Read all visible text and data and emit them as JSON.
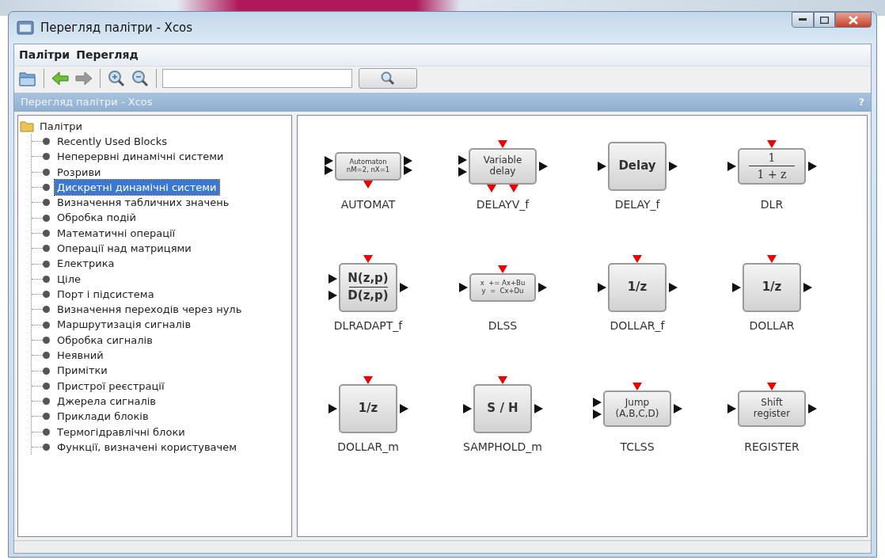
{
  "window": {
    "title": "Перегляд палітри - Xcos"
  },
  "menu": [
    "Палітри",
    "Перегляд"
  ],
  "toolbar": {
    "back": {
      "disabled": false
    },
    "forward": {
      "disabled": true
    }
  },
  "header": {
    "title": "Перегляд палітри - Xcos",
    "help": "?"
  },
  "tree": {
    "label": "Палітри",
    "children": [
      {
        "label": "Recently Used Blocks",
        "selected": false
      },
      {
        "label": "Неперервні динамічні системи",
        "selected": false
      },
      {
        "label": "Розриви",
        "selected": false
      },
      {
        "label": "Дискретні динамічні системи",
        "selected": true
      },
      {
        "label": "Визначення табличних значень",
        "selected": false
      },
      {
        "label": "Обробка подій",
        "selected": false
      },
      {
        "label": "Математичні операції",
        "selected": false
      },
      {
        "label": "Операції над матрицями",
        "selected": false
      },
      {
        "label": "Електрика",
        "selected": false
      },
      {
        "label": "Ціле",
        "selected": false
      },
      {
        "label": "Порт і підсистема",
        "selected": false
      },
      {
        "label": "Визначення переходів через нуль",
        "selected": false
      },
      {
        "label": "Маршрутизація сигналів",
        "selected": false
      },
      {
        "label": "Обробка сигналів",
        "selected": false
      },
      {
        "label": "Неявний",
        "selected": false
      },
      {
        "label": "Примітки",
        "selected": false
      },
      {
        "label": "Пристрої реєстрації",
        "selected": false
      },
      {
        "label": "Джерела сигналів",
        "selected": false
      },
      {
        "label": "Приклади блоків",
        "selected": false
      },
      {
        "label": "Термогідравлічні блоки",
        "selected": false
      },
      {
        "label": "Функції, визначені користувачем",
        "selected": false
      }
    ]
  },
  "blocks": [
    {
      "name": "AUTOMAT",
      "kind": "smalltext",
      "face": [
        "Automaton",
        "nM=2, nX=1"
      ],
      "ports": [
        {
          "kind": "input"
        },
        {
          "kind": "input"
        },
        {
          "kind": "output"
        },
        {
          "kind": "output"
        },
        {
          "kind": "eventout"
        }
      ]
    },
    {
      "name": "DELAYV_f",
      "kind": "text",
      "face": [
        "Variable",
        "delay"
      ],
      "ports": [
        {
          "kind": "input"
        },
        {
          "kind": "input"
        },
        {
          "kind": "output"
        },
        {
          "kind": "eventin"
        },
        {
          "kind": "eventout"
        },
        {
          "kind": "eventout"
        }
      ]
    },
    {
      "name": "DELAY_f",
      "kind": "largetext",
      "face": [
        "Delay"
      ],
      "ports": [
        {
          "kind": "input"
        },
        {
          "kind": "output"
        }
      ]
    },
    {
      "name": "DLR",
      "kind": "fraction",
      "face": [
        "1",
        "1 + z"
      ],
      "ports": [
        {
          "kind": "input"
        },
        {
          "kind": "output"
        },
        {
          "kind": "eventin"
        }
      ]
    },
    {
      "name": "DLRADAPT_f",
      "kind": "largefraction",
      "face": [
        "N(z,p)",
        "D(z,p)"
      ],
      "ports": [
        {
          "kind": "input"
        },
        {
          "kind": "input"
        },
        {
          "kind": "output"
        },
        {
          "kind": "eventin"
        }
      ]
    },
    {
      "name": "DLSS",
      "kind": "smalltext",
      "face": [
        "x  += Ax+Bu",
        "y  =  Cx+Du"
      ],
      "ports": [
        {
          "kind": "input"
        },
        {
          "kind": "output"
        },
        {
          "kind": "eventin"
        }
      ]
    },
    {
      "name": "DOLLAR_f",
      "kind": "largetext",
      "face": [
        "1/z"
      ],
      "ports": [
        {
          "kind": "input"
        },
        {
          "kind": "output"
        },
        {
          "kind": "eventin"
        }
      ]
    },
    {
      "name": "DOLLAR",
      "kind": "largetext",
      "face": [
        "1/z"
      ],
      "ports": [
        {
          "kind": "input"
        },
        {
          "kind": "output"
        },
        {
          "kind": "eventin"
        }
      ]
    },
    {
      "name": "DOLLAR_m",
      "kind": "largetext",
      "face": [
        "1/z"
      ],
      "ports": [
        {
          "kind": "input"
        },
        {
          "kind": "output"
        },
        {
          "kind": "eventin"
        }
      ]
    },
    {
      "name": "SAMPHOLD_m",
      "kind": "largetext",
      "face": [
        "S / H"
      ],
      "ports": [
        {
          "kind": "input"
        },
        {
          "kind": "output"
        },
        {
          "kind": "eventin"
        }
      ]
    },
    {
      "name": "TCLSS",
      "kind": "text",
      "face": [
        "Jump",
        "(A,B,C,D)"
      ],
      "ports": [
        {
          "kind": "input"
        },
        {
          "kind": "input"
        },
        {
          "kind": "output"
        },
        {
          "kind": "eventin"
        }
      ]
    },
    {
      "name": "REGISTER",
      "kind": "text",
      "face": [
        "Shift",
        "register"
      ],
      "ports": [
        {
          "kind": "input"
        },
        {
          "kind": "output"
        },
        {
          "kind": "eventin"
        }
      ]
    }
  ]
}
